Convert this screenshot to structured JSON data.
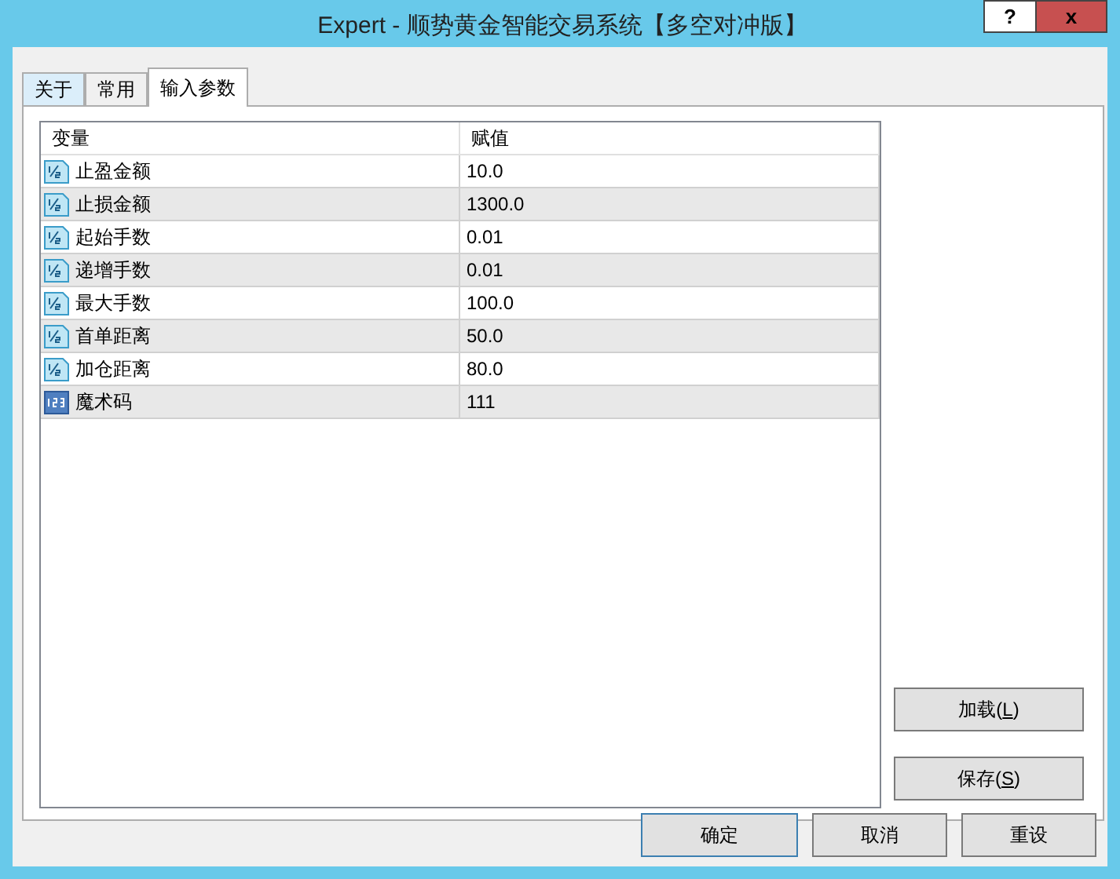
{
  "window": {
    "title": "Expert - 顺势黄金智能交易系统【多空对冲版】",
    "help_button": "?",
    "close_button": "x"
  },
  "tabs": [
    {
      "label": "关于",
      "selected": false
    },
    {
      "label": "常用",
      "selected": false
    },
    {
      "label": "输入参数",
      "selected": true
    }
  ],
  "table": {
    "columns": [
      "变量",
      "赋值"
    ],
    "rows": [
      {
        "kind": "double",
        "name": "止盈金额",
        "value": "10.0"
      },
      {
        "kind": "double",
        "name": "止损金额",
        "value": "1300.0"
      },
      {
        "kind": "double",
        "name": "起始手数",
        "value": "0.01"
      },
      {
        "kind": "double",
        "name": "递增手数",
        "value": "0.01"
      },
      {
        "kind": "double",
        "name": "最大手数",
        "value": "100.0"
      },
      {
        "kind": "double",
        "name": "首单距离",
        "value": "50.0"
      },
      {
        "kind": "double",
        "name": "加仓距离",
        "value": "80.0"
      },
      {
        "kind": "integer",
        "name": "魔术码",
        "value": "111"
      }
    ]
  },
  "side_buttons": [
    {
      "before": "加载(",
      "access_key": "L",
      "after": ")"
    },
    {
      "before": "保存(",
      "access_key": "S",
      "after": ")"
    }
  ],
  "bottom_buttons": [
    {
      "label": "确定",
      "selected": true
    },
    {
      "label": "取消",
      "selected": false
    },
    {
      "label": "重设",
      "selected": false
    }
  ]
}
